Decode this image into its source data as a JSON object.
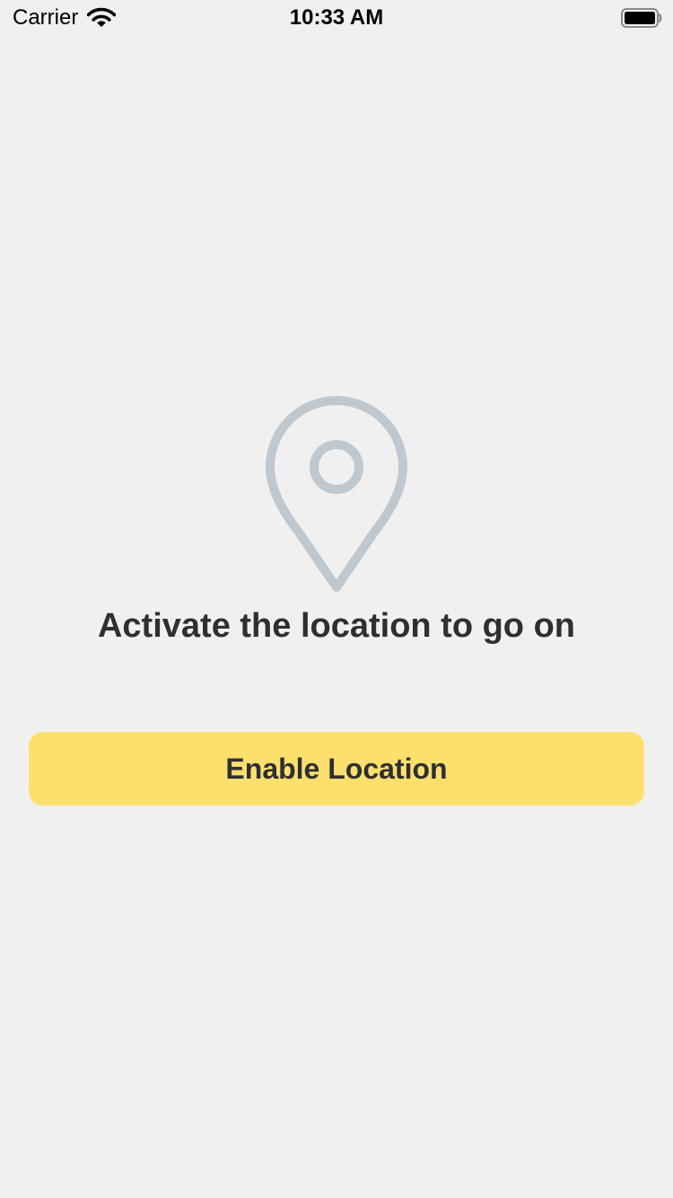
{
  "status_bar": {
    "carrier": "Carrier",
    "time": "10:33 AM",
    "wifi_icon": "wifi-icon",
    "battery_icon": "battery-icon"
  },
  "main": {
    "icon": "location-pin-icon",
    "icon_color": "#bfc7cf",
    "message": "Activate the location to go on",
    "button_label": "Enable Location",
    "button_color": "#fddf6e",
    "text_color": "#2f2f2f",
    "background_color": "#f0f0f0"
  }
}
